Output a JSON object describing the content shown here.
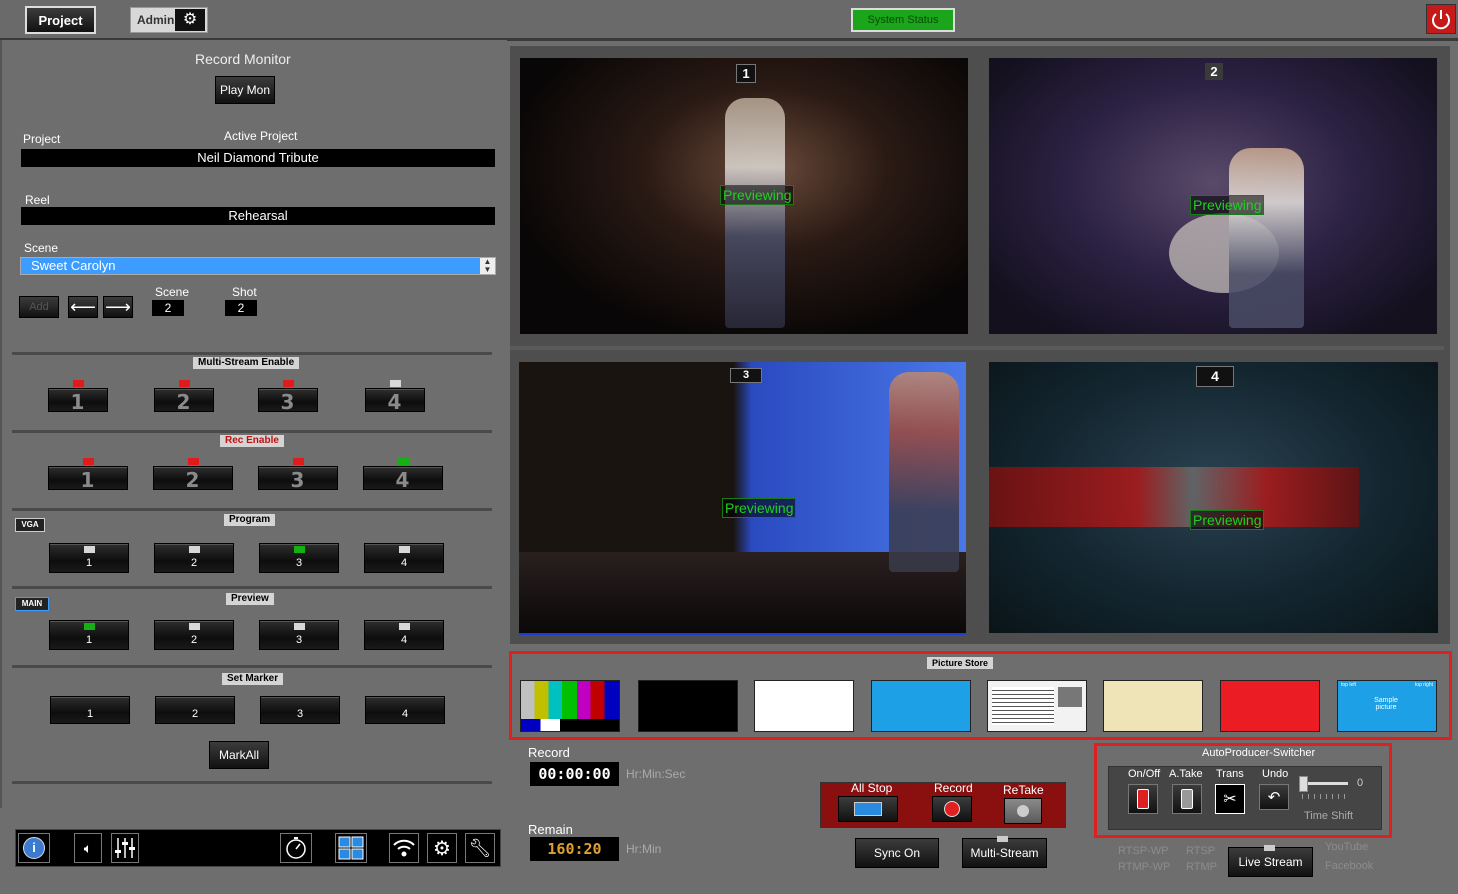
{
  "topbar": {
    "project_label": "Project",
    "admin_label": "Admin",
    "system_status": "System Status"
  },
  "left": {
    "title": "Record Monitor",
    "play_mon": "Play Mon",
    "project_label": "Project",
    "active_project_label": "Active Project",
    "project_value": "Neil Diamond Tribute",
    "reel_label": "Reel",
    "reel_value": "Rehearsal",
    "scene_label": "Scene",
    "scene_value": "Sweet Carolyn",
    "add_label": "Add",
    "scene_num_label": "Scene",
    "scene_num": "2",
    "shot_label": "Shot",
    "shot_num": "2",
    "multistream_title": "Multi-Stream Enable",
    "rec_enable_title": "Rec Enable",
    "vga_tag": "VGA",
    "program_title": "Program",
    "main_tag": "MAIN",
    "preview_title": "Preview",
    "set_marker_title": "Set Marker",
    "markall": "MarkAll",
    "buttons": [
      "1",
      "2",
      "3",
      "4"
    ]
  },
  "cameras": [
    {
      "num": "1",
      "status": "Previewing"
    },
    {
      "num": "2",
      "status": "Previewing"
    },
    {
      "num": "3",
      "status": "Previewing"
    },
    {
      "num": "4",
      "status": "Previewing"
    }
  ],
  "picture_store": {
    "title": "Picture Store",
    "sample_text": "Sample picture",
    "sample_corner_left": "top left",
    "sample_corner_right": "top right"
  },
  "record": {
    "label": "Record",
    "time": "00:00:00",
    "time_unit": "Hr:Min:Sec",
    "remain_label": "Remain",
    "remain": "160:20",
    "remain_unit": "Hr:Min"
  },
  "transport": {
    "all_stop": "All Stop",
    "record": "Record",
    "retake": "ReTake",
    "sync_on": "Sync On",
    "multi_stream": "Multi-Stream",
    "live_stream": "Live Stream",
    "rtsp_wp": "RTSP-WP",
    "rtmp_wp": "RTMP-WP",
    "rtsp": "RTSP",
    "rtmp": "RTMP",
    "youtube": "YouTube",
    "facebook": "Facebook"
  },
  "autoproducer": {
    "title": "AutoProducer-Switcher",
    "onoff": "On/Off",
    "atake": "A.Take",
    "trans": "Trans",
    "undo": "Undo",
    "slider_value": "0",
    "time_shift": "Time Shift"
  },
  "colors": {
    "status_green": "#1aa51a",
    "accent_red": "#e02020",
    "scene_blue": "#3c9cff"
  },
  "icons": [
    "gear-icon",
    "power-icon",
    "info-icon",
    "speaker-icon",
    "mixer-icon",
    "timer-icon",
    "grid-icon",
    "wifi-icon",
    "settings-icon",
    "tools-icon",
    "scissors-icon",
    "undo-icon"
  ]
}
